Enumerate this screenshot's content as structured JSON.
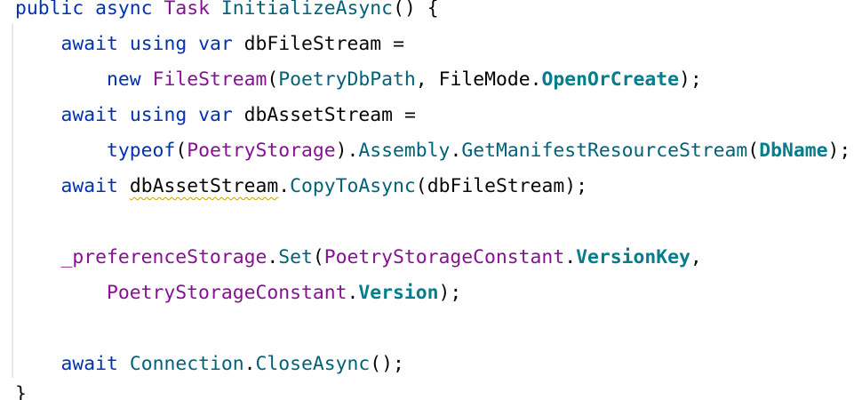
{
  "code": {
    "line1": {
      "kw1": "public",
      "kw2": "async",
      "type": "Task",
      "method": "InitializeAsync",
      "parens": "()",
      "brace": "{"
    },
    "line2": {
      "kw1": "await",
      "kw2": "using",
      "kw3": "var",
      "var": "dbFileStream",
      "op": "="
    },
    "line3": {
      "kw": "new",
      "type": "FileStream",
      "open": "(",
      "arg1": "PoetryDbPath",
      "comma": ",",
      "enum": "FileMode",
      "dot": ".",
      "member": "OpenOrCreate",
      "close": ");"
    },
    "line4": {
      "kw1": "await",
      "kw2": "using",
      "kw3": "var",
      "var": "dbAssetStream",
      "op": "="
    },
    "line5": {
      "kw": "typeof",
      "open": "(",
      "cls": "PoetryStorage",
      "close1": ")",
      "dot1": ".",
      "prop": "Assembly",
      "dot2": ".",
      "method": "GetManifestResourceStream",
      "open2": "(",
      "arg": "DbName",
      "close2": ");"
    },
    "line6": {
      "kw": "await",
      "var": "dbAssetStream",
      "dot": ".",
      "method": "CopyToAsync",
      "open": "(",
      "arg": "dbFileStream",
      "close": ");"
    },
    "line8": {
      "field": "_preferenceStorage",
      "dot": ".",
      "method": "Set",
      "open": "(",
      "cls": "PoetryStorageConstant",
      "dot2": ".",
      "member": "VersionKey",
      "comma": ","
    },
    "line9": {
      "cls": "PoetryStorageConstant",
      "dot": ".",
      "member": "Version",
      "close": ");"
    },
    "line11": {
      "kw": "await",
      "prop": "Connection",
      "dot": ".",
      "method": "CloseAsync",
      "close": "();"
    },
    "line12": {
      "brace": "}"
    }
  }
}
